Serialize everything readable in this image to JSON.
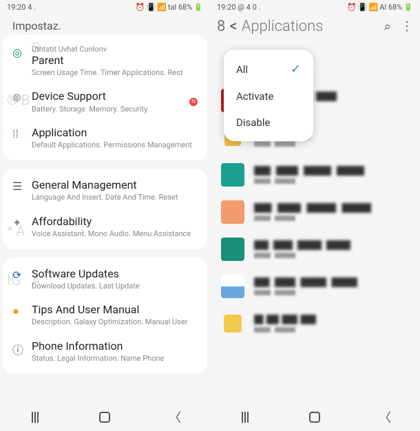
{
  "left": {
    "status": {
      "time": "19:20 4 .",
      "battery": "tal 68%"
    },
    "header": "Impostaz.",
    "cards": [
      {
        "items": [
          {
            "icon": "wellbeing",
            "title_prefix": "Uthtstit Uvhat Cunlonv",
            "title": "Parent",
            "sub": "Screen Usage Time. Timer Applications. Rest"
          },
          {
            "icon": "care",
            "title": "Device Support",
            "sub": "Battery. Storage. Memory. Security",
            "badge": "N"
          },
          {
            "icon": "apps",
            "title": "Application",
            "sub": "Default Applications. Permissions Management"
          }
        ]
      },
      {
        "items": [
          {
            "icon": "general",
            "title": "General Management",
            "sub": "Language And Insert. Date And Time. Reset"
          },
          {
            "icon": "accessibility",
            "title": "Affordability",
            "sub": "Voice Assistant. Mono Audio. Menu Assistance"
          }
        ]
      },
      {
        "items": [
          {
            "icon": "update",
            "title": "Software Updates",
            "sub": "Download Updates. Last Update"
          },
          {
            "icon": "tips",
            "title": "Tips And User Manual",
            "sub": "Description. Galaxy Optimization. Manual User"
          },
          {
            "icon": "about",
            "title": "Phone Information",
            "sub": "Status. Legal Information. Name Phone"
          }
        ]
      }
    ],
    "ghosts": {
      "g1": "S",
      "g2": "® B",
      "g3": "(",
      "g4": "* A",
      "g5": "IG",
      "g6": "A"
    }
  },
  "right": {
    "status": {
      "time": "19:20 @ 4 0 .",
      "battery": "Al 68%"
    },
    "header": {
      "count": "8",
      "title": "Applications"
    },
    "dropdown": {
      "all": "All",
      "activate": "Activate",
      "disable": "Disable"
    },
    "apps": [
      {
        "color": "#b02020"
      },
      {
        "color": "#f2b84b"
      },
      {
        "color": "#1a9e8f"
      },
      {
        "color": "#f29b6b"
      },
      {
        "color": "#1a8f7a"
      },
      {
        "color": "#6ba8e0"
      },
      {
        "color": "#f2c94b"
      },
      {
        "color": "#888888"
      }
    ]
  }
}
